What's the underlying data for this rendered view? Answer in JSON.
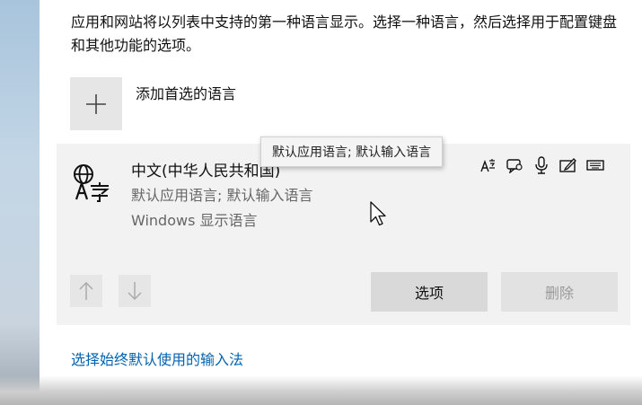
{
  "description": "应用和网站将以列表中支持的第一种语言显示。选择一种语言，然后选择用于配置键盘和其他功能的选项。",
  "add_language_label": "添加首选的语言",
  "language": {
    "name": "中文(中华人民共和国)",
    "subtitle_1": "默认应用语言; 默认输入语言",
    "subtitle_2": "Windows 显示语言",
    "icon": "language-glyph-icon",
    "feature_icons": [
      "language-pack-icon",
      "speech-icon",
      "microphone-icon",
      "handwriting-icon",
      "keyboard-icon"
    ]
  },
  "tooltip": "默认应用语言; 默认输入语言",
  "buttons": {
    "options": "选项",
    "remove": "删除"
  },
  "link": "选择始终默认使用的输入法",
  "colors": {
    "accent_link": "#0063b1",
    "panel_bg": "#f2f2f2",
    "button_bg": "#d9d9d9"
  }
}
